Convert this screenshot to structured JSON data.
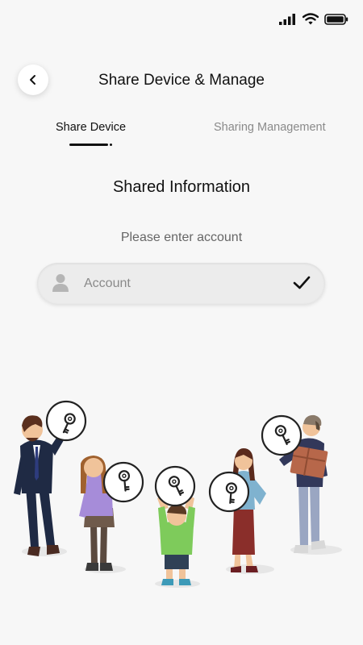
{
  "header": {
    "title": "Share Device & Manage",
    "back_icon": "chevron-left-icon"
  },
  "tabs": [
    {
      "label": "Share Device",
      "active": true
    },
    {
      "label": "Sharing Management",
      "active": false
    }
  ],
  "main": {
    "section_title": "Shared Information",
    "prompt": "Please enter account",
    "account_field": {
      "value": "",
      "placeholder": "Account",
      "leading_icon": "user-icon",
      "trailing_icon": "check-icon"
    }
  },
  "status_bar": {
    "icons": [
      "signal-icon",
      "wifi-icon",
      "battery-icon"
    ]
  },
  "illustration": {
    "subject": "people-holding-keys-illustration",
    "icon": "key-icon"
  },
  "colors": {
    "background": "#f7f7f7",
    "text": "#111111",
    "inactive_tab": "#8a8a8a",
    "field": "#ececec"
  }
}
